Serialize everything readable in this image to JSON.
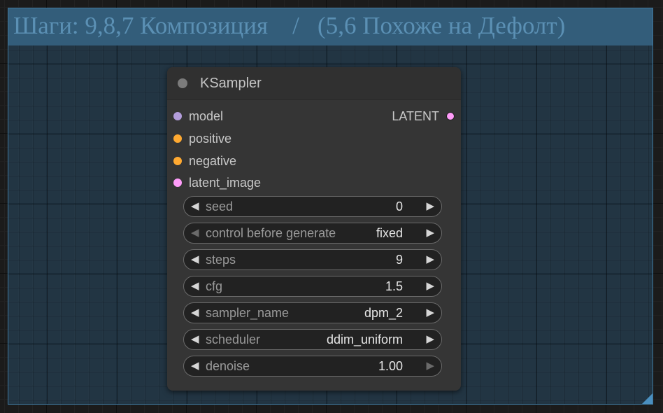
{
  "group": {
    "title": "Шаги: 9,8,7 Композиция    /   (5,6 Похоже на Дефолт)",
    "color": "#335d7a"
  },
  "node": {
    "title": "KSampler",
    "inputs": [
      {
        "label": "model",
        "color": "#b39ddb"
      },
      {
        "label": "positive",
        "color": "#ffa931"
      },
      {
        "label": "negative",
        "color": "#ffa931"
      },
      {
        "label": "latent_image",
        "color": "#ff9cf9"
      }
    ],
    "output": {
      "label": "LATENT",
      "color": "#ff9cf9"
    },
    "widgets": [
      {
        "label": "seed",
        "value": "0",
        "right_arrow_enabled": true,
        "left_arrow_enabled": true
      },
      {
        "label": "control before generate",
        "value": "fixed",
        "right_arrow_enabled": true,
        "left_arrow_enabled": false
      },
      {
        "label": "steps",
        "value": "9",
        "right_arrow_enabled": true,
        "left_arrow_enabled": true
      },
      {
        "label": "cfg",
        "value": "1.5",
        "right_arrow_enabled": true,
        "left_arrow_enabled": true
      },
      {
        "label": "sampler_name",
        "value": "dpm_2",
        "right_arrow_enabled": true,
        "left_arrow_enabled": true
      },
      {
        "label": "scheduler",
        "value": "ddim_uniform",
        "right_arrow_enabled": true,
        "left_arrow_enabled": true
      },
      {
        "label": "denoise",
        "value": "1.00",
        "right_arrow_enabled": false,
        "left_arrow_enabled": true
      }
    ],
    "arrow_left_glyph": "◀",
    "arrow_right_glyph": "▶"
  }
}
